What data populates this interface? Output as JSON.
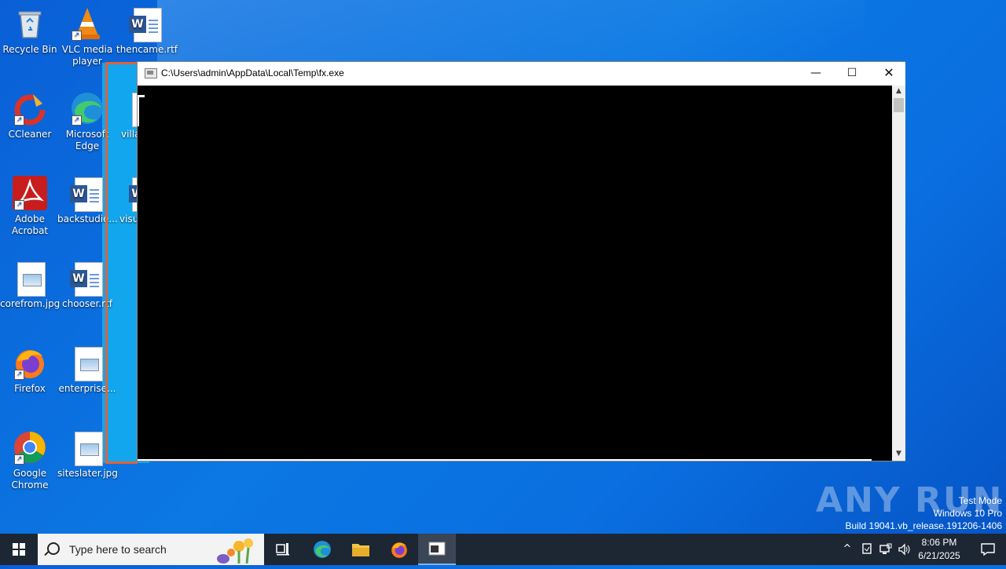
{
  "desktop": {
    "icons": [
      {
        "label": "Recycle Bin"
      },
      {
        "label": "VLC media player"
      },
      {
        "label": "thencame.rtf"
      },
      {
        "label": "CCleaner"
      },
      {
        "label": "Microsoft Edge"
      },
      {
        "label": "villa"
      },
      {
        "label": "Adobe Acrobat"
      },
      {
        "label": "backstudie..."
      },
      {
        "label": "visu"
      },
      {
        "label": "corefrom.jpg"
      },
      {
        "label": "chooser.rtf"
      },
      {
        "label": "Firefox"
      },
      {
        "label": "enterprise..."
      },
      {
        "label": "Google Chrome"
      },
      {
        "label": "siteslater.jpg"
      }
    ]
  },
  "console": {
    "title": "C:\\Users\\admin\\AppData\\Local\\Temp\\fx.exe",
    "minimize_glyph": "—",
    "maximize_glyph": "☐",
    "close_glyph": "✕"
  },
  "watermark": {
    "text": "ANY RUN"
  },
  "system_info": {
    "line1": "Test Mode",
    "line2": "Windows 10 Pro",
    "line3": "Build 19041.vb_release.191206-1406"
  },
  "taskbar": {
    "search_placeholder": "Type here to search",
    "time": "8:06 PM",
    "date": "6/21/2025"
  },
  "colors": {
    "accent": "#e0623a",
    "taskbar": "#1d2633",
    "desktop": "#0a6fe0"
  }
}
